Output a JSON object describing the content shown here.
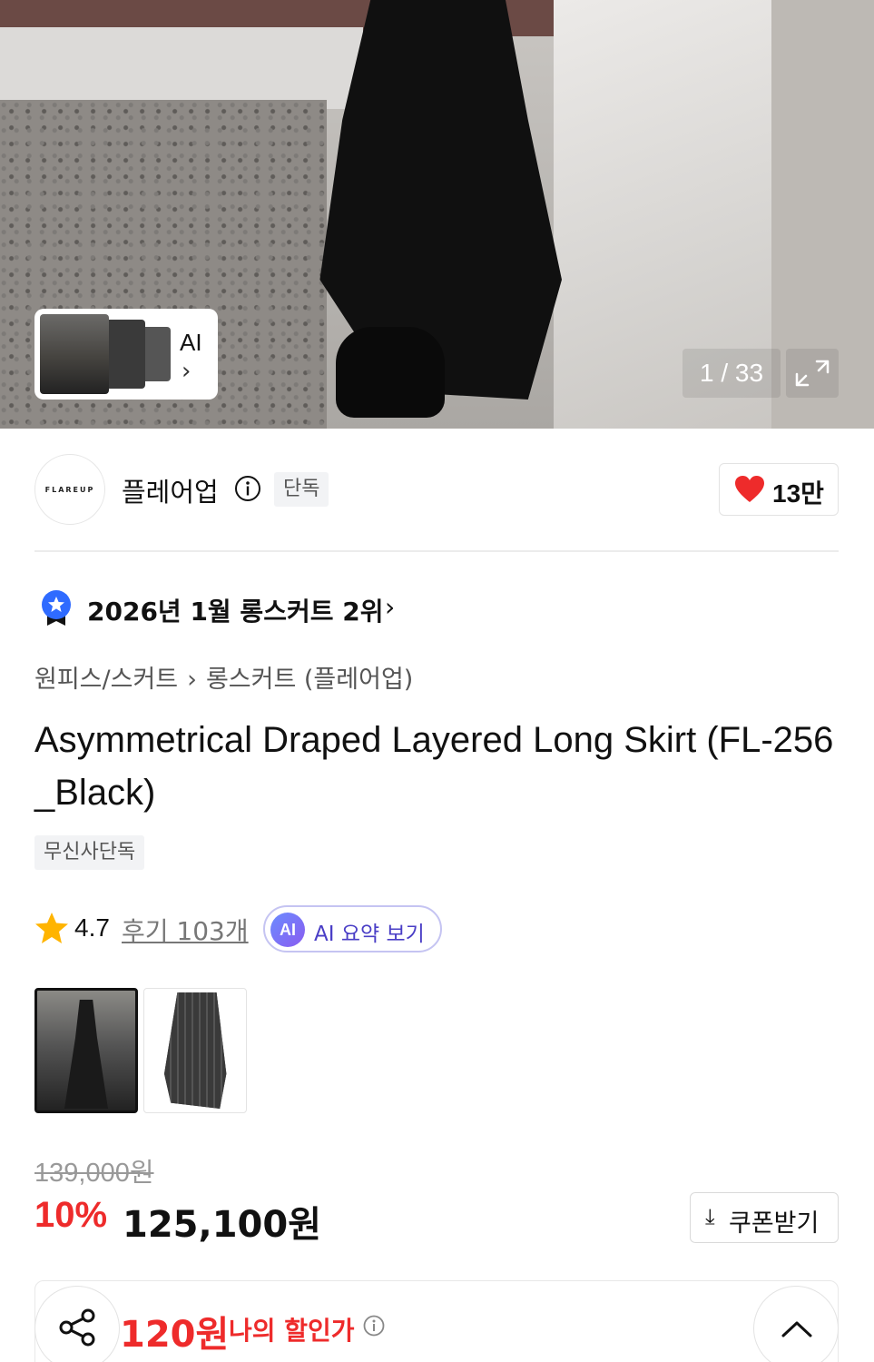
{
  "hero": {
    "ai_label": "AI",
    "ai_arrow": "›",
    "counter": "1 / 33",
    "expand_icon": "expand-icon"
  },
  "brand": {
    "logo_text": "FLAREUP",
    "name": "플레어업",
    "badge": "단독",
    "likes": "13만",
    "heart_color": "#ee2b2b"
  },
  "rank": {
    "text": "2026년 1월 롱스커트 2위",
    "chevron": "›"
  },
  "breadcrumb": {
    "category": "원피스/스커트",
    "separator": "›",
    "subcategory": "롱스커트 (플레어업)"
  },
  "product": {
    "title": "Asymmetrical Draped Layered Long Skirt (FL-256_Black)",
    "tag": "무신사단독"
  },
  "rating": {
    "score": "4.7",
    "reviews": "후기 103개",
    "ai_badge": "AI",
    "ai_summary": "AI 요약 보기"
  },
  "price": {
    "original": "139,000원",
    "discount": "10%",
    "current": "125,100원",
    "coupon_label": "쿠폰받기",
    "coupon_icon": "⤓",
    "accent_color": "#ee2b2b"
  },
  "bottom": {
    "my_price": "120원",
    "my_label": "나의 할인가"
  }
}
